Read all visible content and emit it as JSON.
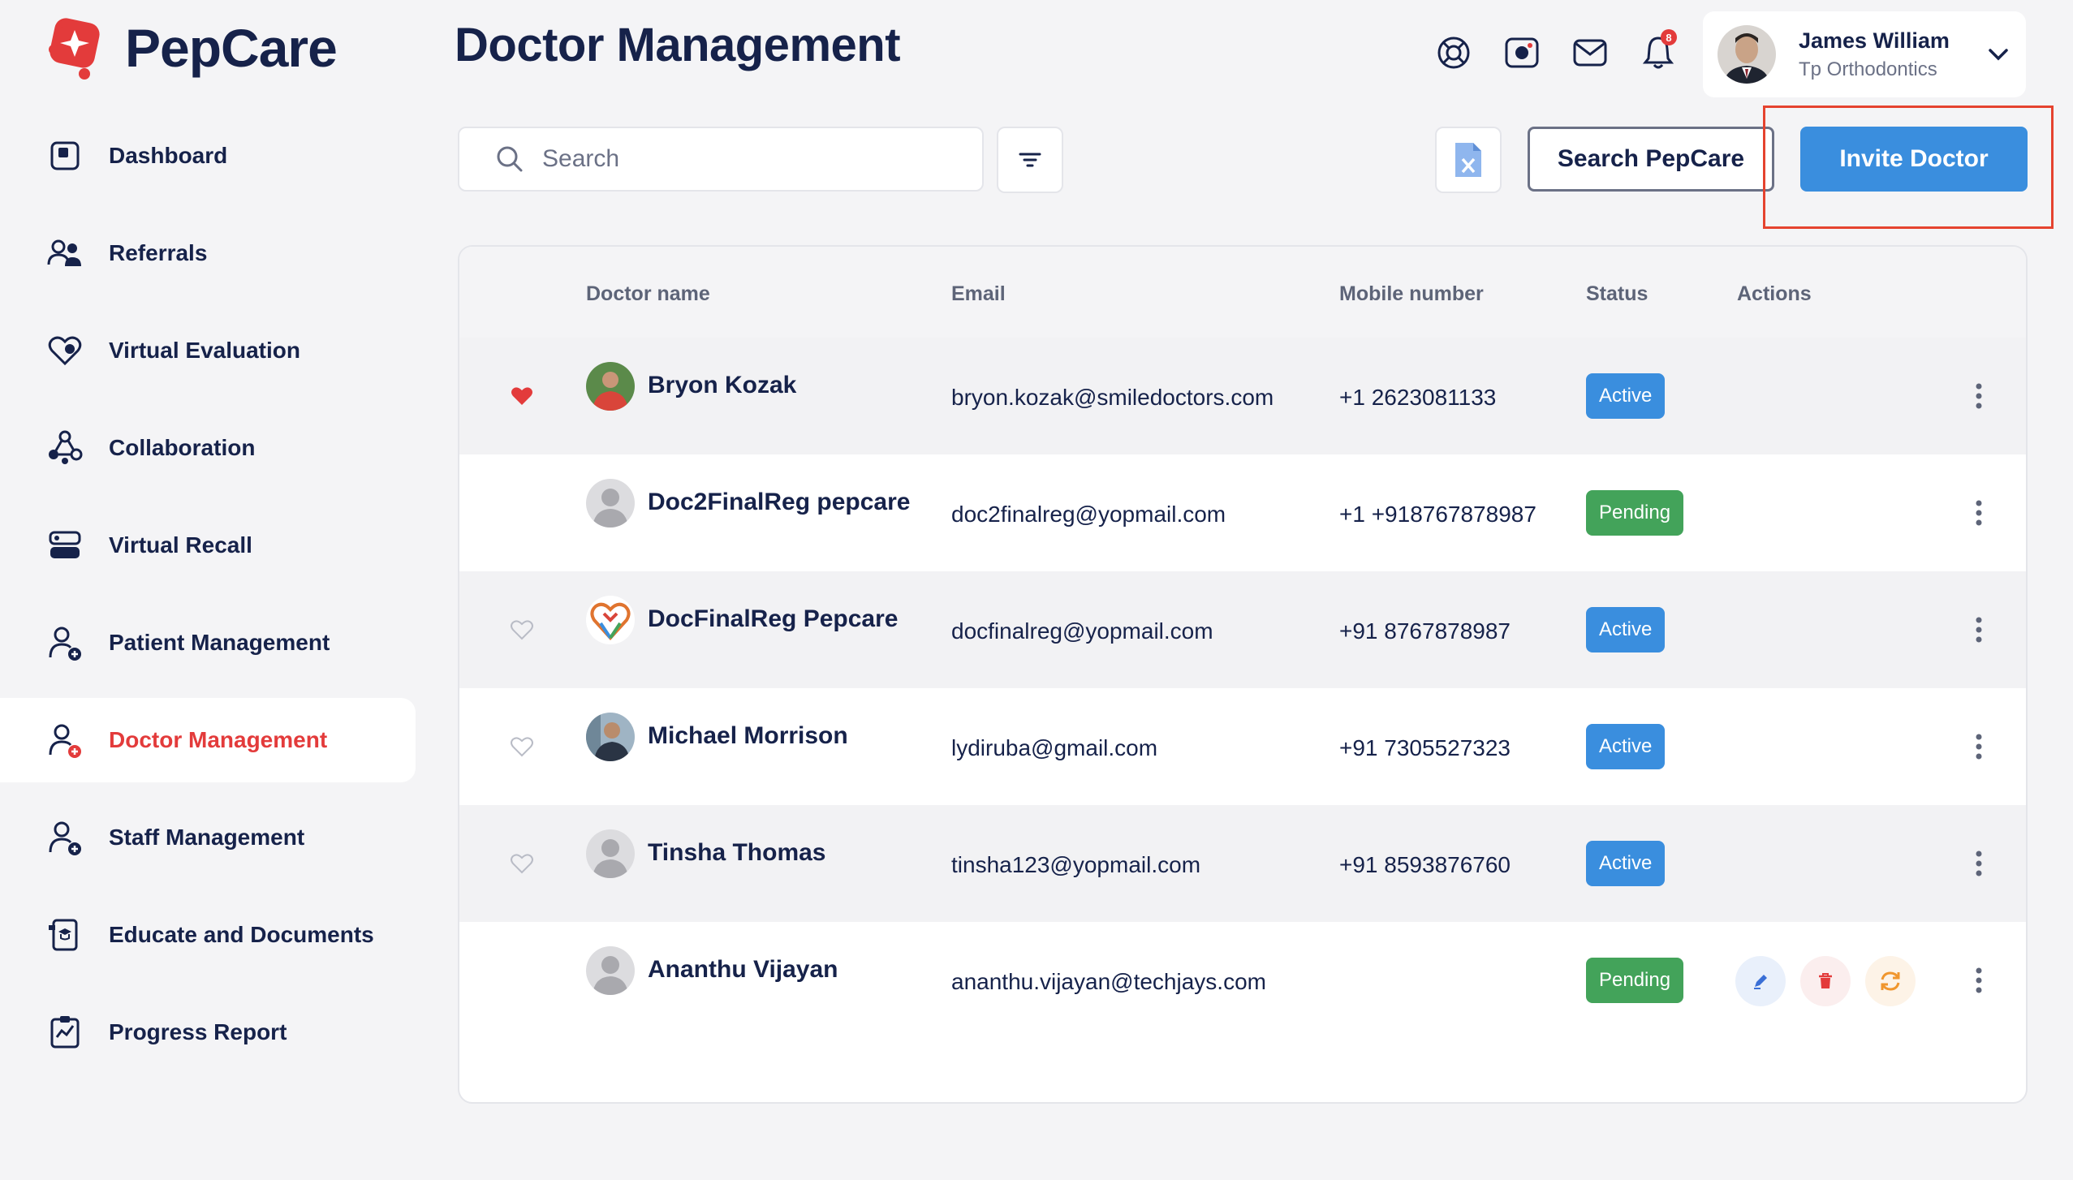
{
  "app": {
    "name": "PepCare"
  },
  "page": {
    "title": "Doctor Management"
  },
  "user": {
    "name": "James William",
    "organization": "Tp Orthodontics"
  },
  "header": {
    "notification_count": "8"
  },
  "sidebar": {
    "items": [
      {
        "label": "Dashboard",
        "icon": "dashboard-icon"
      },
      {
        "label": "Referrals",
        "icon": "referrals-icon"
      },
      {
        "label": "Virtual Evaluation",
        "icon": "heart-icon"
      },
      {
        "label": "Collaboration",
        "icon": "collaboration-icon"
      },
      {
        "label": "Virtual Recall",
        "icon": "recall-icon"
      },
      {
        "label": "Patient Management",
        "icon": "patient-icon"
      },
      {
        "label": "Doctor Management",
        "icon": "doctor-icon",
        "active": true
      },
      {
        "label": "Staff Management",
        "icon": "staff-icon"
      },
      {
        "label": "Educate and Documents",
        "icon": "documents-icon"
      },
      {
        "label": "Progress Report",
        "icon": "progress-report-icon"
      }
    ]
  },
  "toolbar": {
    "search_placeholder": "Search",
    "search_pepcare_label": "Search PepCare",
    "invite_doctor_label": "Invite Doctor"
  },
  "table": {
    "columns": [
      "Doctor name",
      "Email",
      "Mobile number",
      "Status",
      "Actions"
    ],
    "rows": [
      {
        "name": "Bryon Kozak",
        "email": "bryon.kozak@smiledoctors.com",
        "mobile": "+1 2623081133",
        "status": "Active",
        "favorite": true,
        "avatar": "photo-red-shirt"
      },
      {
        "name": "Doc2FinalReg pepcare",
        "email": "doc2finalreg@yopmail.com",
        "mobile": "+1 +918767878987",
        "status": "Pending",
        "favorite": null,
        "avatar": "placeholder"
      },
      {
        "name": "DocFinalReg Pepcare",
        "email": "docfinalreg@yopmail.com",
        "mobile": "+91 8767878987",
        "status": "Active",
        "favorite": false,
        "avatar": "heart-logo"
      },
      {
        "name": "Michael Morrison",
        "email": "lydiruba@gmail.com",
        "mobile": "+91 7305527323",
        "status": "Active",
        "favorite": false,
        "avatar": "photo-outdoor"
      },
      {
        "name": "Tinsha Thomas",
        "email": "tinsha123@yopmail.com",
        "mobile": "+91 8593876760",
        "status": "Active",
        "favorite": false,
        "avatar": "placeholder"
      },
      {
        "name": "Ananthu Vijayan",
        "email": "ananthu.vijayan@techjays.com",
        "mobile": "",
        "status": "Pending",
        "favorite": null,
        "avatar": "placeholder",
        "show_actions": true
      }
    ]
  },
  "colors": {
    "brand_red": "#e33b3b",
    "navy": "#16224a",
    "active_blue": "#3a8ede",
    "pending_green": "#43a35a",
    "highlight_border": "#e5432f"
  }
}
